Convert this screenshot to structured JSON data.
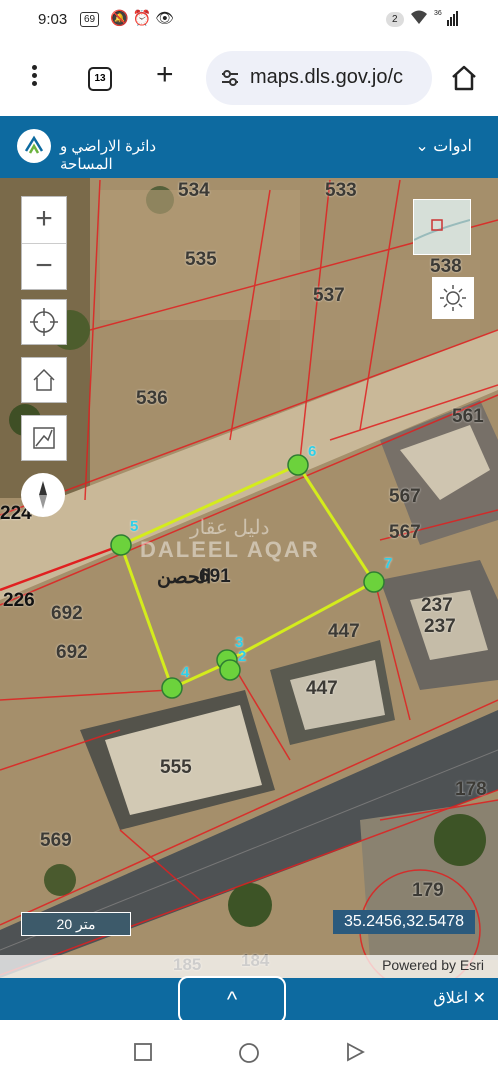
{
  "status": {
    "time": "9:03",
    "badge": "69",
    "icons": "🔕⏰👁",
    "notif_count": "2",
    "network": "36"
  },
  "browser": {
    "tab_count": "13",
    "url": "maps.dls.gov.jo/c"
  },
  "app": {
    "title": "دائرة الاراضي و المساحة",
    "tools_label": "ادوات"
  },
  "map": {
    "zoom_in": "+",
    "zoom_out": "−",
    "parcels": [
      "534",
      "533",
      "535",
      "538",
      "537",
      "536",
      "561",
      "567",
      "567",
      "237",
      "237",
      "447",
      "447",
      "691",
      "692",
      "692",
      "226",
      "224",
      "555",
      "569",
      "178",
      "179",
      "185",
      "184"
    ],
    "place_name": "الحصن",
    "watermark_latin": "DALEEL AQAR",
    "watermark_arabic": "دليل عقار",
    "vertices": [
      "3",
      "2",
      "4",
      "5",
      "6",
      "7"
    ],
    "scale": "20 متر",
    "coordinates": "35.2456,32.5478",
    "attribution": "Powered by Esri"
  },
  "bottom": {
    "expand": "^",
    "close": "اغلاق ✕"
  },
  "colors": {
    "header": "#0d6aa0",
    "parcel_outline": "#d4ec1c",
    "vertex": "#6cd23c",
    "boundary": "#e02020"
  }
}
